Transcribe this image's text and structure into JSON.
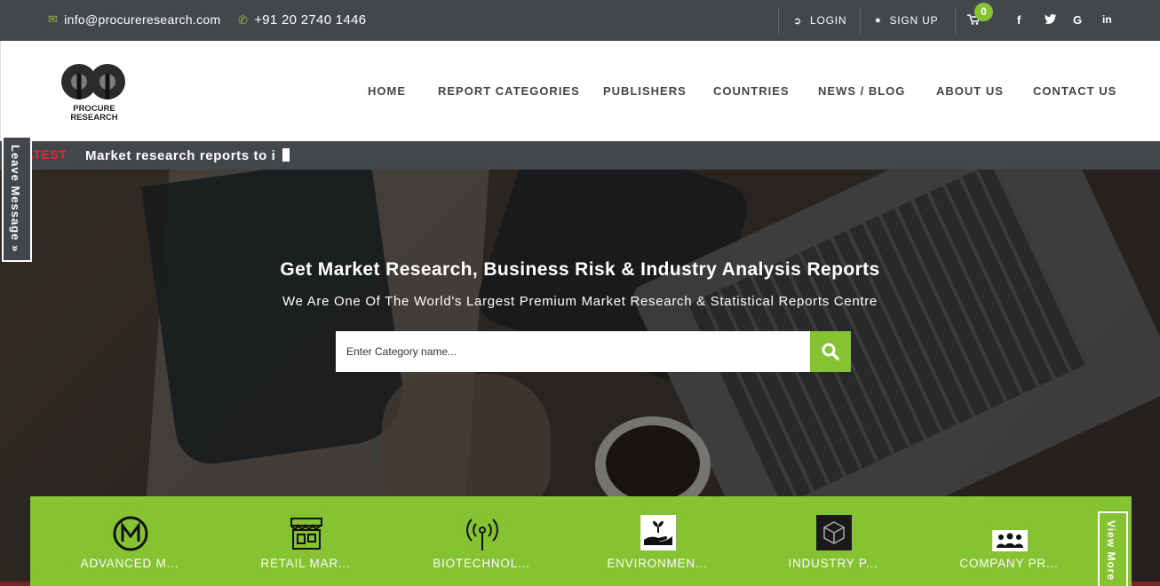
{
  "topbar": {
    "email": "info@procureresearch.com",
    "phone": "+91 20 2740 1446",
    "login": "LOGIN",
    "signup": "SIGN UP",
    "cart_count": "0",
    "social": [
      "f",
      "t",
      "G",
      "in"
    ]
  },
  "header": {
    "logo_text_line1": "PROCURE",
    "logo_text_line2": "RESEARCH",
    "nav": [
      "HOME",
      "REPORT CATEGORIES",
      "PUBLISHERS",
      "COUNTRIES",
      "NEWS / BLOG",
      "ABOUT US",
      "CONTACT US"
    ]
  },
  "ticker": {
    "label": "ATEST",
    "text": "Market research reports to i"
  },
  "leave_message": "Leave Message »",
  "hero": {
    "title": "Get Market Research, Business Risk & Industry Analysis Reports",
    "subtitle": "We Are One Of The World's Largest Premium Market Research & Statistical Reports Centre",
    "search_placeholder": "Enter Category name..."
  },
  "categories": [
    {
      "label": "ADVANCED M...",
      "icon": "m-circle-icon"
    },
    {
      "label": "RETAIL MAR...",
      "icon": "storefront-icon"
    },
    {
      "label": "BIOTECHNOL...",
      "icon": "antenna-icon"
    },
    {
      "label": "ENVIRONMEN...",
      "icon": "plant-hand-icon"
    },
    {
      "label": "INDUSTRY P...",
      "icon": "cube-icon"
    },
    {
      "label": "COMPANY PR...",
      "icon": "people-icon"
    }
  ],
  "view_more": "View More",
  "colors": {
    "accent": "#86c332",
    "bar": "#43474c",
    "ticker_label": "#e52a2a"
  }
}
